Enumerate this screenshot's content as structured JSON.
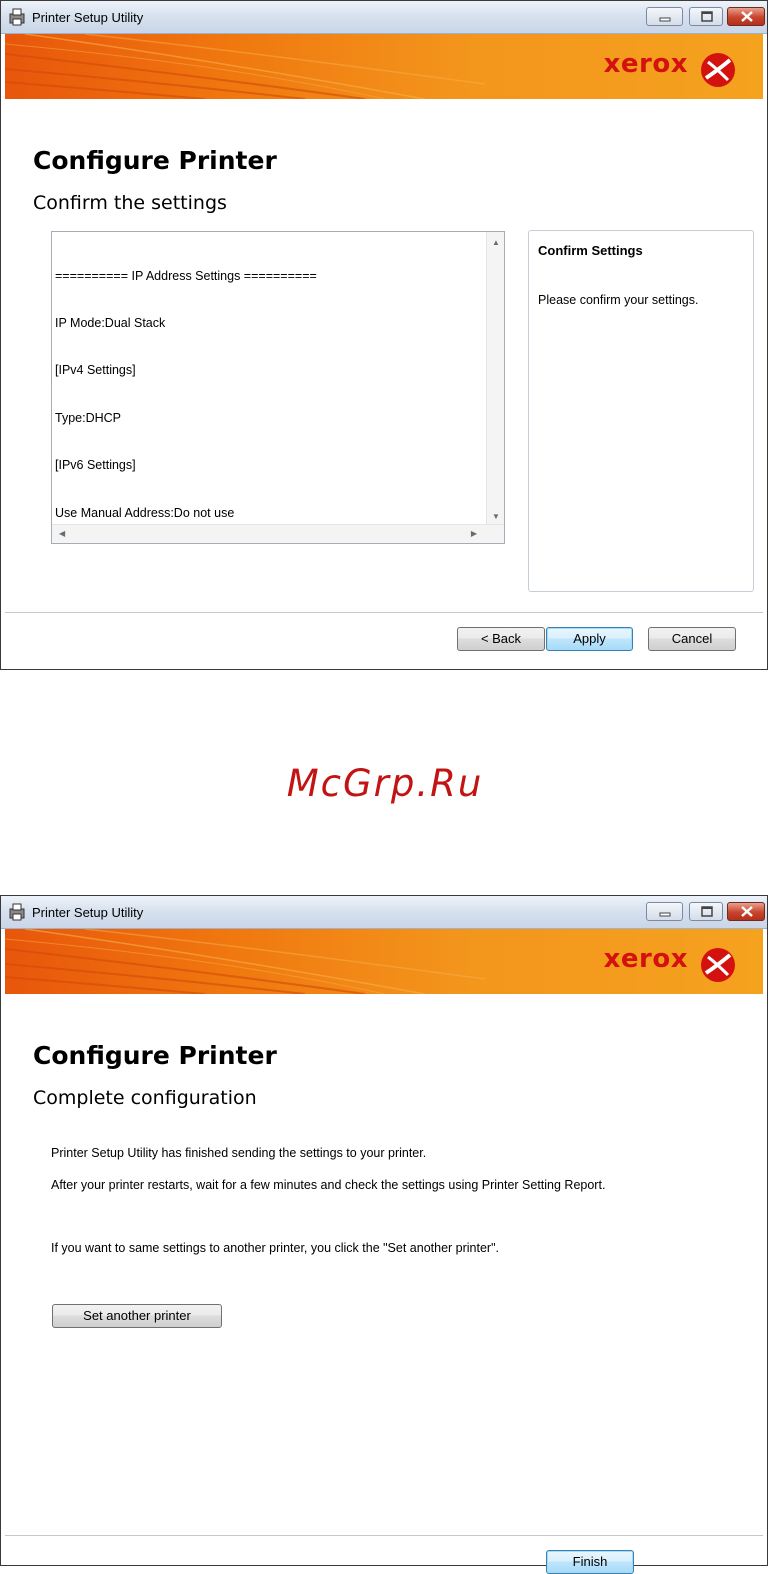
{
  "window1": {
    "title": "Printer Setup Utility",
    "brand": "xerox",
    "heading": "Configure Printer",
    "subheading": "Confirm the settings",
    "settings_lines": [
      "========== IP Address Settings ==========",
      "IP Mode:Dual Stack",
      "[IPv4 Settings]",
      "Type:DHCP",
      "[IPv6 Settings]",
      "Use Manual Address:Do not use"
    ],
    "info_title": "Confirm Settings",
    "info_text": "Please confirm your settings.",
    "back_button": "< Back",
    "apply_button": "Apply",
    "cancel_button": "Cancel"
  },
  "watermark": "McGrp.Ru",
  "window2": {
    "title": "Printer Setup Utility",
    "brand": "xerox",
    "heading": "Configure Printer",
    "subheading": "Complete configuration",
    "line1": "Printer Setup Utility has finished sending the settings to your printer.",
    "line2": "After your printer restarts, wait for a few minutes and check the settings using Printer Setting Report.",
    "line3": "If you want to same settings to another printer, you click the \"Set another printer\".",
    "set_another_button": "Set another printer",
    "finish_button": "Finish"
  },
  "colors": {
    "brand_red": "#d3120f",
    "banner_orange": "#f0780f",
    "watermark_red": "#c21414"
  }
}
